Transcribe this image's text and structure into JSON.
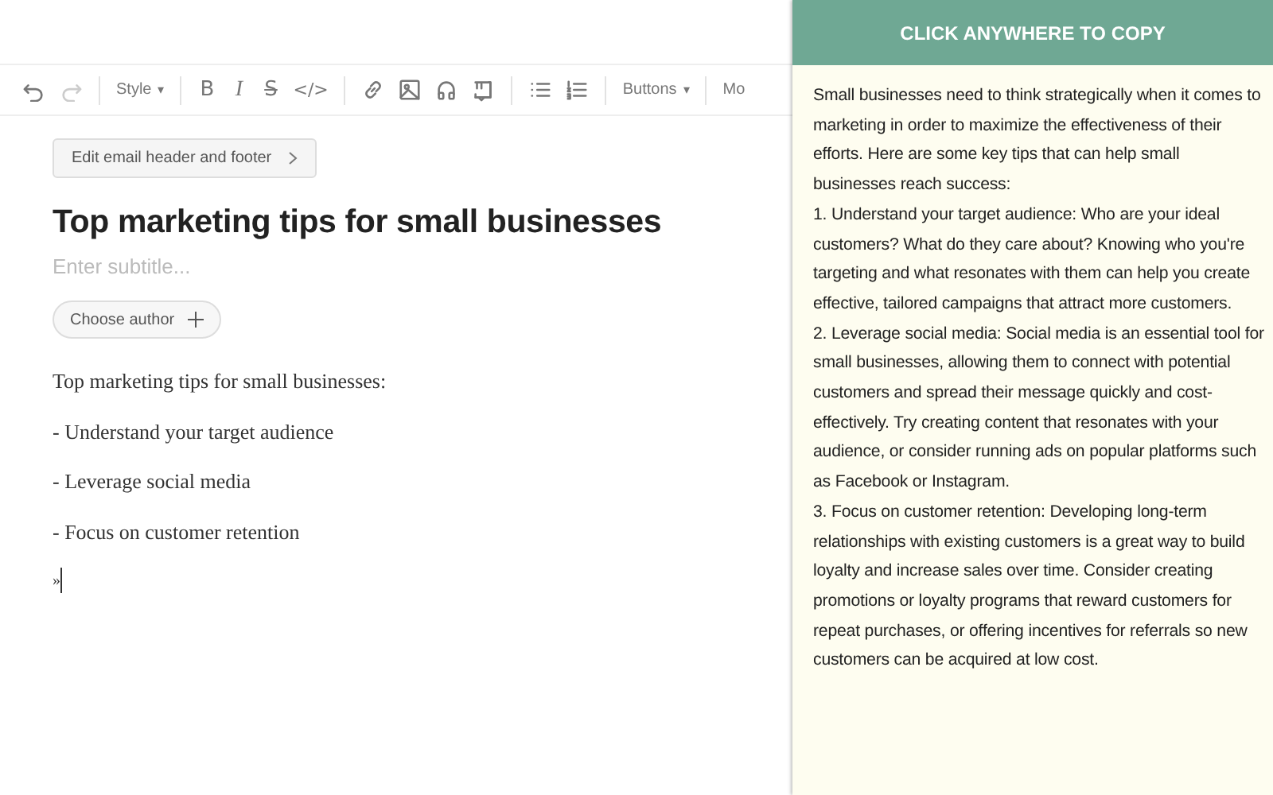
{
  "toolbar": [
    {
      "kind": "undo",
      "disabled": false
    },
    {
      "kind": "redo",
      "disabled": true
    },
    {
      "kind": "divider"
    },
    {
      "kind": "dropdown",
      "label": "Style",
      "caret": "▾"
    },
    {
      "kind": "divider"
    },
    {
      "kind": "bold",
      "label": "B"
    },
    {
      "kind": "italic",
      "label": "I"
    },
    {
      "kind": "strike",
      "label": "S"
    },
    {
      "kind": "code",
      "label": "</>"
    },
    {
      "kind": "divider"
    },
    {
      "kind": "link"
    },
    {
      "kind": "image"
    },
    {
      "kind": "audio"
    },
    {
      "kind": "quote"
    },
    {
      "kind": "divider"
    },
    {
      "kind": "bullets"
    },
    {
      "kind": "numbers"
    },
    {
      "kind": "divider"
    },
    {
      "kind": "dropdown",
      "label": "Buttons",
      "caret": "▾"
    },
    {
      "kind": "divider"
    },
    {
      "kind": "text",
      "label": "Mo"
    }
  ],
  "editor": {
    "header_button": "Edit email header and footer",
    "title": "Top marketing tips for small businesses",
    "subtitle_placeholder": "Enter subtitle...",
    "author_button": "Choose author",
    "paragraphs": [
      "Top marketing tips for small businesses:",
      "- Understand your target audience",
      "- Leverage social media",
      "- Focus on customer retention"
    ],
    "cursor_line": "»"
  },
  "copy_panel": {
    "header": "CLICK ANYWHERE TO COPY",
    "paragraphs": [
      "Small businesses need to think strategically when it comes to marketing in order to maximize the effectiveness of their efforts. Here are some key tips that can help small businesses reach success:",
      "1. Understand your target audience: Who are your ideal customers? What do they care about? Knowing who you're targeting and what resonates with them can help you create effective, tailored campaigns that attract more customers.",
      "2. Leverage social media: Social media is an essential tool for small businesses, allowing them to connect with potential customers and spread their message quickly and cost-effectively. Try creating content that resonates with your audience, or consider running ads on popular platforms such as Facebook or Instagram.",
      "3. Focus on customer retention: Developing long-term relationships with existing customers is a great way to build loyalty and increase sales over time. Consider creating promotions or loyalty programs that reward customers for repeat purchases, or offering incentives for referrals so new customers can be acquired at low cost."
    ]
  }
}
